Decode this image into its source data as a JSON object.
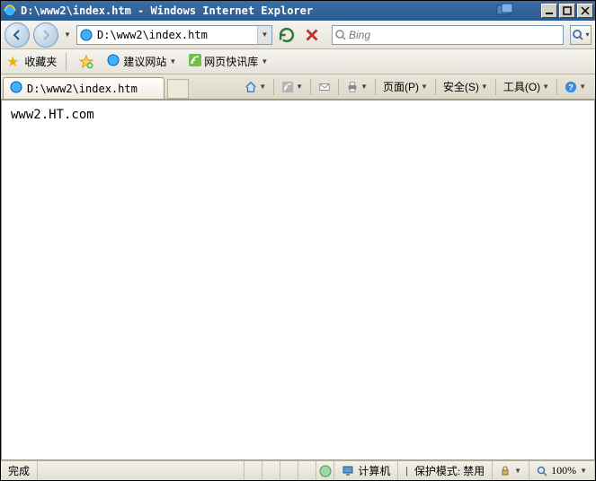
{
  "title": "D:\\www2\\index.htm - Windows Internet Explorer",
  "address": "D:\\www2\\index.htm",
  "search": {
    "placeholder": "Bing"
  },
  "favbar": {
    "label": "收藏夹",
    "suggested": "建议网站",
    "slice": "网页快讯库"
  },
  "tab": {
    "label": "D:\\www2\\index.htm"
  },
  "commands": {
    "page": "页面(P)",
    "safety": "安全(S)",
    "tools": "工具(O)"
  },
  "content": "www2.HT.com",
  "status": {
    "done": "完成",
    "zone": "计算机",
    "protected": "保护模式: 禁用",
    "zoom": "100%"
  }
}
